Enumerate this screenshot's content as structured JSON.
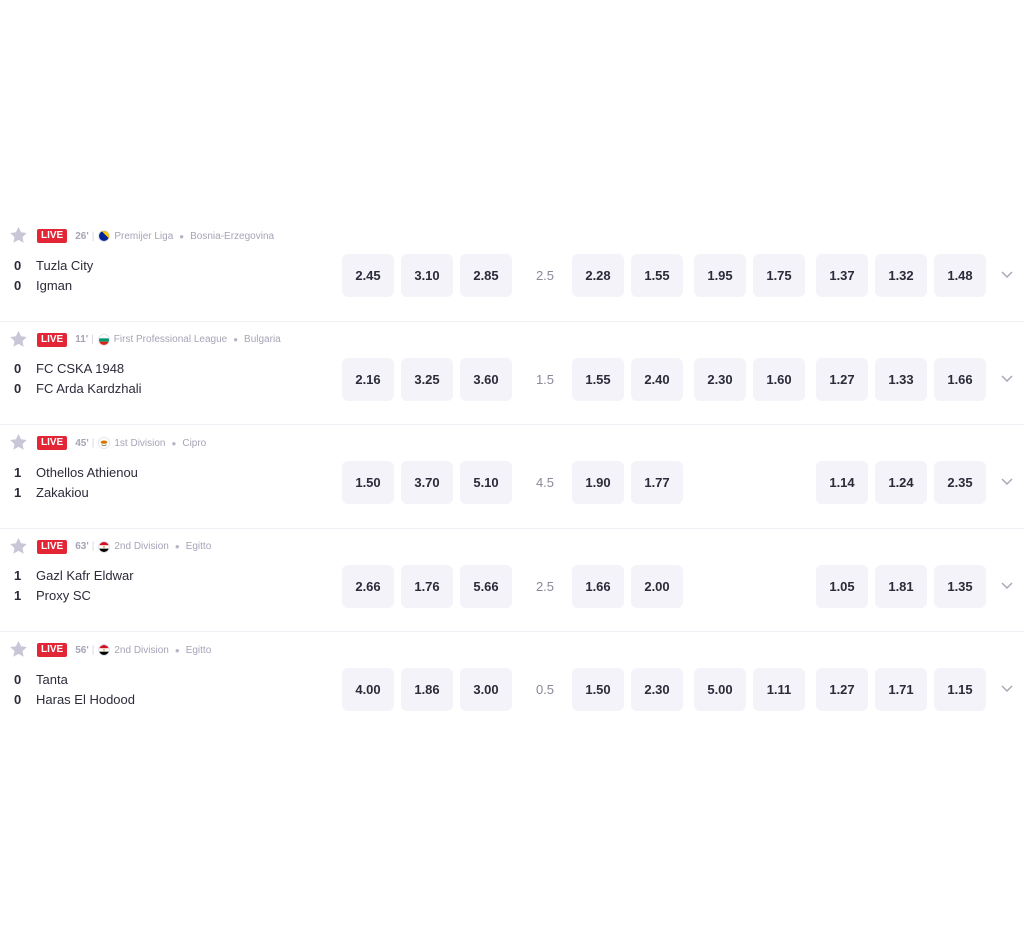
{
  "live_label": "LIVE",
  "events": [
    {
      "minute": "26'",
      "flag": "bosnia-flag",
      "league": "Premijer Liga",
      "country": "Bosnia-Erzegovina",
      "home": {
        "score": "0",
        "name": "Tuzla City"
      },
      "away": {
        "score": "0",
        "name": "Igman"
      },
      "odds_1x2": [
        "2.45",
        "3.10",
        "2.85"
      ],
      "line": "2.5",
      "odds_ou": [
        "2.28",
        "1.55"
      ],
      "odds_extra": [
        "1.95",
        "1.75"
      ],
      "odds_dc": [
        "1.37",
        "1.32",
        "1.48"
      ]
    },
    {
      "minute": "11'",
      "flag": "bulgaria-flag",
      "league": "First Professional League",
      "country": "Bulgaria",
      "home": {
        "score": "0",
        "name": "FC CSKA 1948"
      },
      "away": {
        "score": "0",
        "name": "FC Arda Kardzhali"
      },
      "odds_1x2": [
        "2.16",
        "3.25",
        "3.60"
      ],
      "line": "1.5",
      "odds_ou": [
        "1.55",
        "2.40"
      ],
      "odds_extra": [
        "2.30",
        "1.60"
      ],
      "odds_dc": [
        "1.27",
        "1.33",
        "1.66"
      ]
    },
    {
      "minute": "45'",
      "flag": "cyprus-flag",
      "league": "1st Division",
      "country": "Cipro",
      "home": {
        "score": "1",
        "name": "Othellos Athienou"
      },
      "away": {
        "score": "1",
        "name": "Zakakiou"
      },
      "odds_1x2": [
        "1.50",
        "3.70",
        "5.10"
      ],
      "line": "4.5",
      "odds_ou": [
        "1.90",
        "1.77"
      ],
      "odds_extra": [],
      "odds_dc": [
        "1.14",
        "1.24",
        "2.35"
      ]
    },
    {
      "minute": "63'",
      "flag": "egypt-flag",
      "league": "2nd Division",
      "country": "Egitto",
      "home": {
        "score": "1",
        "name": "Gazl Kafr Eldwar"
      },
      "away": {
        "score": "1",
        "name": "Proxy SC"
      },
      "odds_1x2": [
        "2.66",
        "1.76",
        "5.66"
      ],
      "line": "2.5",
      "odds_ou": [
        "1.66",
        "2.00"
      ],
      "odds_extra": [],
      "odds_dc": [
        "1.05",
        "1.81",
        "1.35"
      ]
    },
    {
      "minute": "56'",
      "flag": "egypt-flag",
      "league": "2nd Division",
      "country": "Egitto",
      "home": {
        "score": "0",
        "name": "Tanta"
      },
      "away": {
        "score": "0",
        "name": "Haras El Hodood"
      },
      "odds_1x2": [
        "4.00",
        "1.86",
        "3.00"
      ],
      "line": "0.5",
      "odds_ou": [
        "1.50",
        "2.30"
      ],
      "odds_extra": [
        "5.00",
        "1.11"
      ],
      "odds_dc": [
        "1.27",
        "1.71",
        "1.15"
      ]
    }
  ],
  "colors": {
    "live_badge": "#e32636",
    "odd_button_bg": "#f4f3f9",
    "star": "#c9c6d8"
  }
}
